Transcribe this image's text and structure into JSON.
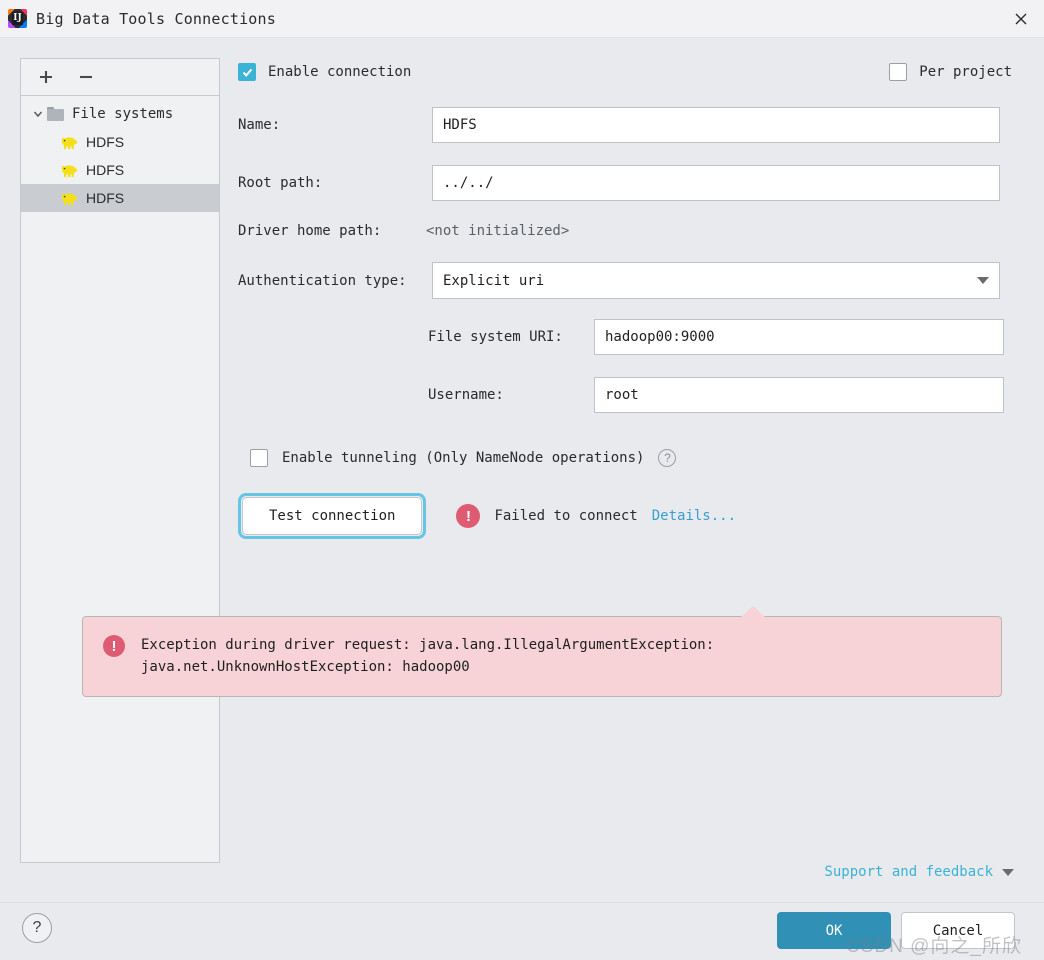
{
  "window": {
    "title": "Big Data Tools Connections",
    "app_icon": "intellij-idea-icon",
    "close_icon": "close-icon"
  },
  "sidebar": {
    "toolbar": {
      "add_label": "+",
      "remove_label": "−"
    },
    "tree": [
      {
        "label": "File systems",
        "icon": "folder-icon",
        "expanded": true,
        "selected": false
      },
      {
        "label": "HDFS",
        "icon": "hadoop-elephant-icon",
        "selected": false
      },
      {
        "label": "HDFS",
        "icon": "hadoop-elephant-icon",
        "selected": false
      },
      {
        "label": "HDFS",
        "icon": "hadoop-elephant-icon",
        "selected": true
      }
    ]
  },
  "form": {
    "enable_connection": {
      "label": "Enable connection",
      "checked": true
    },
    "per_project": {
      "label": "Per project",
      "checked": false
    },
    "name": {
      "label": "Name:",
      "value": "HDFS"
    },
    "root_path": {
      "label": "Root path:",
      "value": "../../"
    },
    "driver_home_path": {
      "label": "Driver home path:",
      "value": "<not initialized>"
    },
    "auth_type": {
      "label": "Authentication type:",
      "value": "Explicit uri"
    },
    "file_system_uri": {
      "label": "File system URI:",
      "value": "hadoop00:9000"
    },
    "username": {
      "label": "Username:",
      "value": "root"
    },
    "enable_tunneling": {
      "label": "Enable tunneling (Only NameNode operations)",
      "checked": false,
      "help_icon": "question-mark-icon"
    },
    "test_connection": {
      "label": "Test connection"
    },
    "status": {
      "icon": "error-icon",
      "text": "Failed to connect",
      "details_link": "Details..."
    }
  },
  "error_balloon": {
    "icon": "error-icon",
    "line1": "Exception during driver request: java.lang.IllegalArgumentException:",
    "line2": "java.net.UnknownHostException: hadoop00"
  },
  "support": {
    "label": "Support and feedback",
    "dropdown_icon": "chevron-down-icon"
  },
  "footer": {
    "help_label": "?",
    "ok_label": "OK",
    "cancel_label": "Cancel"
  },
  "watermark": {
    "text": "CSDN @向之_所欣"
  },
  "colors": {
    "accent": "#3ab3d4",
    "ok_button": "#3090b5",
    "error": "#dd5c73",
    "balloon_bg": "#f7d3d7",
    "link": "#389fd6",
    "dialog_bg": "#e8eaed"
  }
}
